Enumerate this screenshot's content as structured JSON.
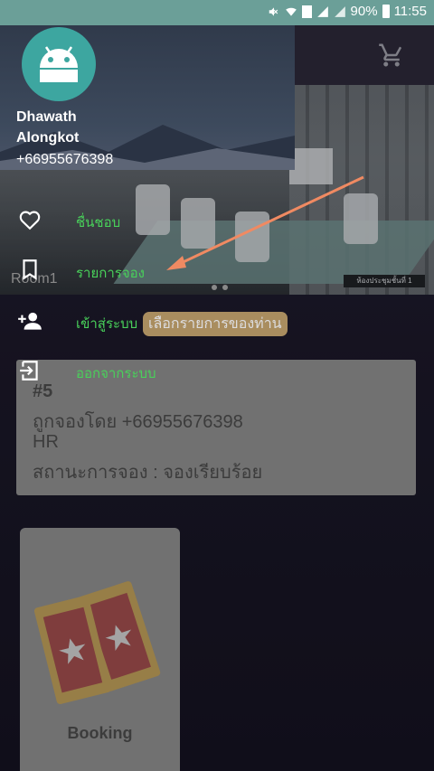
{
  "status_bar": {
    "battery": "90%",
    "time": "11:55"
  },
  "drawer": {
    "user": {
      "first_name": "Dhawath",
      "last_name": "Alongkot",
      "phone": "+66955676398"
    },
    "items": [
      {
        "label": "ชื่นชอบ",
        "icon": "heart-outline-icon"
      },
      {
        "label": "รายการจอง",
        "icon": "bookmark-icon"
      },
      {
        "label": "เข้าสู่ระบบ",
        "icon": "add-person-icon"
      },
      {
        "label": "ออกจากระบบ",
        "icon": "logout-icon"
      }
    ]
  },
  "hint": {
    "text": "เลือกรายการของท่าน"
  },
  "background": {
    "room_label": "Room1",
    "banner_caption": "ห้องประชุมชั้นที่ 1",
    "booking": {
      "number": "#5",
      "booked_by": "ถูกจองโดย +66955676398",
      "department": "HR",
      "status": "สถานะการจอง : จองเรียบร้อย"
    },
    "tile_label": "Booking"
  },
  "colors": {
    "status_bar": "#6b9f98",
    "menu_label": "#49d15a",
    "arrow": "#f08a62",
    "hint_bg": "#c3a36a"
  }
}
